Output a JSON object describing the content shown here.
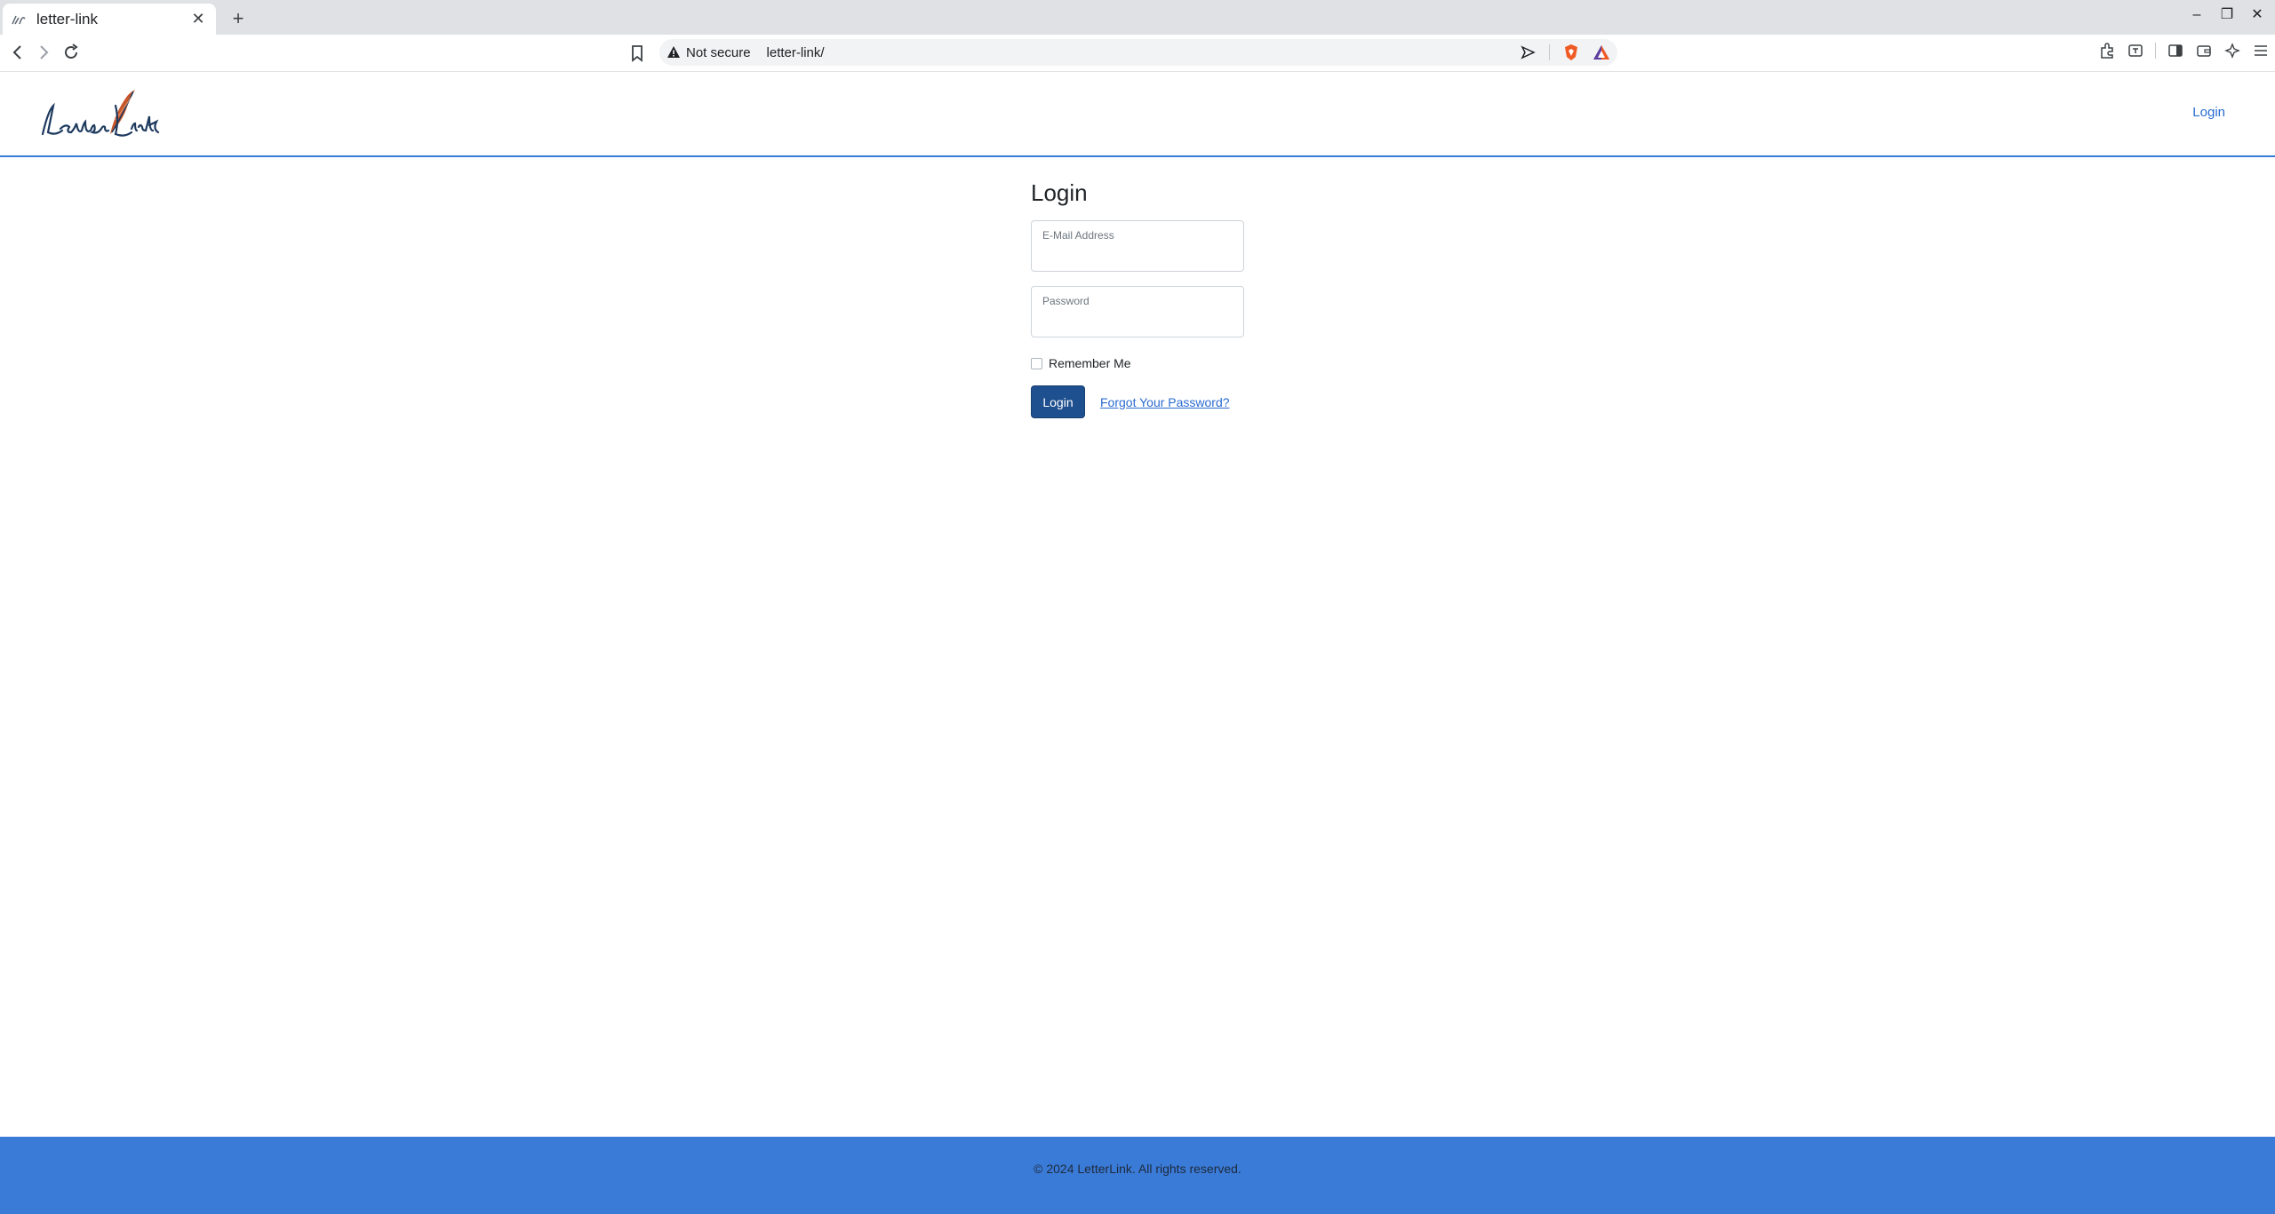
{
  "browser": {
    "tab_title": "letter-link",
    "new_tab": "+",
    "security_label": "Not secure",
    "url": "letter-link/"
  },
  "header": {
    "login_link": "Login"
  },
  "login": {
    "title": "Login",
    "email_label": "E-Mail Address",
    "password_label": "Password",
    "remember_label": "Remember Me",
    "submit_label": "Login",
    "forgot_link": "Forgot Your Password?"
  },
  "footer": {
    "text": "© 2024 LetterLink. All rights reserved."
  },
  "colors": {
    "brand_blue": "#3b7bd8",
    "button_blue": "#1e4f8e",
    "link_blue": "#2a6bd0"
  }
}
